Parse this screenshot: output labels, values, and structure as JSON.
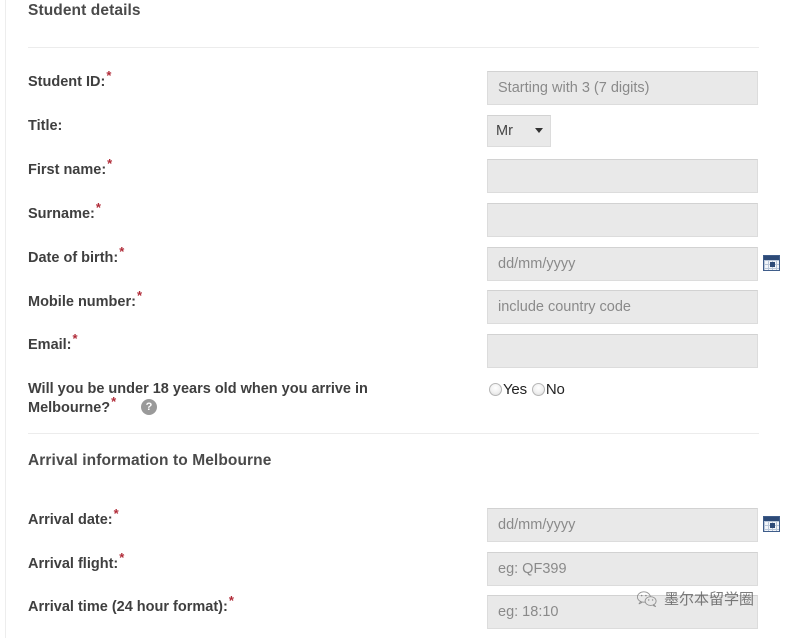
{
  "sections": [
    {
      "title": "Student details"
    },
    {
      "title": "Arrival information to Melbourne"
    }
  ],
  "student_details": {
    "student_id": {
      "label": "Student ID:",
      "required": true,
      "placeholder": "Starting with 3 (7 digits)",
      "value": ""
    },
    "title": {
      "label": "Title:",
      "required": false,
      "value": "Mr",
      "options": [
        "Mr"
      ]
    },
    "first_name": {
      "label": "First name:",
      "required": true,
      "placeholder": "",
      "value": ""
    },
    "surname": {
      "label": "Surname:",
      "required": true,
      "placeholder": "",
      "value": ""
    },
    "date_of_birth": {
      "label": "Date of birth:",
      "required": true,
      "placeholder": "dd/mm/yyyy",
      "value": "",
      "icon": "calendar-icon"
    },
    "mobile_number": {
      "label": "Mobile number:",
      "required": true,
      "placeholder": "include country code",
      "value": ""
    },
    "email": {
      "label": "Email:",
      "required": true,
      "placeholder": "",
      "value": ""
    },
    "under_18": {
      "label": "Will you be under 18 years old when you arrive in Melbourne?",
      "required": true,
      "help_icon": "help-icon",
      "help_glyph": "?",
      "options": [
        {
          "label": "Yes",
          "selected": false
        },
        {
          "label": "No",
          "selected": false
        }
      ]
    }
  },
  "arrival_information": {
    "arrival_date": {
      "label": "Arrival date:",
      "required": true,
      "placeholder": "dd/mm/yyyy",
      "value": "",
      "icon": "calendar-icon"
    },
    "arrival_flight": {
      "label": "Arrival flight:",
      "required": true,
      "placeholder": "eg: QF399",
      "value": ""
    },
    "arrival_time": {
      "label": "Arrival time (24 hour format):",
      "required": true,
      "placeholder": "eg: 18:10",
      "value": ""
    }
  },
  "watermark": {
    "text": "墨尔本留学圈",
    "logo": "wechat-logo"
  },
  "colors": {
    "required_asterisk": "#b02a37",
    "label_text": "#3f3f3f",
    "section_title": "#4a4a4a",
    "input_background": "#e9e9e9",
    "input_border": "#dcdcdc",
    "placeholder_text": "#8a8a8a",
    "divider": "#ececec",
    "calendar_icon_accent": "#2d4a77",
    "help_icon_background": "#9a9a9a"
  }
}
